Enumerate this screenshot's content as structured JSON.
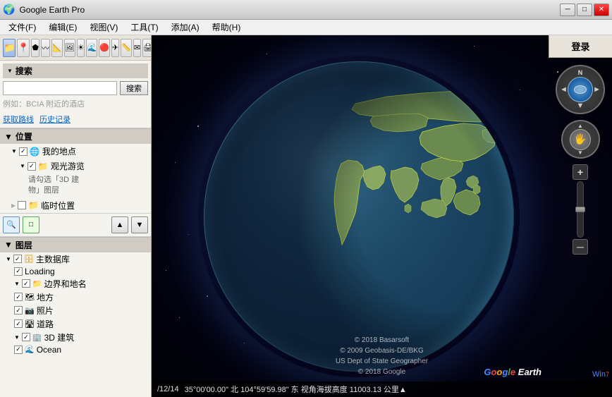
{
  "window": {
    "title": "Google Earth Pro",
    "icon": "🌍"
  },
  "titlebar": {
    "title": "Google Earth Pro",
    "minimize_label": "─",
    "maximize_label": "□",
    "close_label": "✕"
  },
  "menubar": {
    "items": [
      {
        "id": "file",
        "label": "文件(F)"
      },
      {
        "id": "edit",
        "label": "编辑(E)"
      },
      {
        "id": "view",
        "label": "视图(V)"
      },
      {
        "id": "tools",
        "label": "工具(T)"
      },
      {
        "id": "add",
        "label": "添加(A)"
      },
      {
        "id": "help",
        "label": "帮助(H)"
      }
    ]
  },
  "toolbar": {
    "buttons": [
      {
        "id": "folder",
        "icon": "📁",
        "active": true
      },
      {
        "id": "placemark",
        "icon": "📍"
      },
      {
        "id": "polygon",
        "icon": "⬟"
      },
      {
        "id": "path",
        "icon": "〰"
      },
      {
        "id": "measure",
        "icon": "📐"
      },
      {
        "id": "image",
        "icon": "🖼"
      },
      {
        "id": "sun",
        "icon": "☀"
      },
      {
        "id": "ocean",
        "icon": "🌊"
      },
      {
        "id": "mars",
        "icon": "🔴"
      },
      {
        "id": "flight",
        "icon": "✈"
      },
      {
        "id": "ruler",
        "icon": "📏"
      },
      {
        "id": "email",
        "icon": "✉"
      },
      {
        "id": "print",
        "icon": "🖨"
      },
      {
        "id": "movie",
        "icon": "🎬"
      },
      {
        "id": "map2",
        "icon": "🗺"
      }
    ]
  },
  "search": {
    "section_label": "搜索",
    "input_placeholder": "",
    "button_label": "搜索",
    "hint": "例如：BCIA 附近的酒店",
    "links": [
      {
        "id": "route",
        "label": "获取路线"
      },
      {
        "id": "history",
        "label": "历史记录"
      }
    ]
  },
  "position": {
    "section_label": "位置",
    "items": [
      {
        "id": "my-places",
        "label": "我的地点",
        "level": 0,
        "checked": true,
        "icon": "globe"
      },
      {
        "id": "sightseeing",
        "label": "观光游览",
        "level": 1,
        "checked": true,
        "icon": "folder"
      },
      {
        "id": "3d-buildings",
        "label": "请勾选「3D 建\n物」图层",
        "level": 2,
        "checked": false,
        "icon": "text"
      },
      {
        "id": "temp-places",
        "label": "临时位置",
        "level": 0,
        "checked": false,
        "icon": "folder"
      }
    ]
  },
  "nav_buttons": [
    {
      "id": "zoom-in-nav",
      "icon": "🔍",
      "type": "zoom"
    },
    {
      "id": "map-nav",
      "icon": "🗺",
      "type": "map"
    },
    {
      "id": "blank1",
      "icon": ""
    },
    {
      "id": "up-arrow",
      "icon": "▲"
    },
    {
      "id": "down-arrow",
      "icon": "▼"
    }
  ],
  "layers": {
    "section_label": "图层",
    "items": [
      {
        "id": "main-db",
        "label": "主数据库",
        "level": 0,
        "checked": true,
        "icon": "db"
      },
      {
        "id": "loading",
        "label": "Loading",
        "level": 1,
        "checked": true,
        "icon": "check"
      },
      {
        "id": "borders",
        "label": "边界和地名",
        "level": 1,
        "checked": true,
        "icon": "folder"
      },
      {
        "id": "local",
        "label": "地方",
        "level": 1,
        "checked": true,
        "icon": "map"
      },
      {
        "id": "photos",
        "label": "照片",
        "level": 1,
        "checked": true,
        "icon": "photo"
      },
      {
        "id": "roads",
        "label": "道路",
        "level": 1,
        "checked": true,
        "icon": "road"
      },
      {
        "id": "3d-build",
        "label": "3D 建筑",
        "level": 1,
        "checked": true,
        "icon": "building"
      },
      {
        "id": "ocean",
        "label": "Ocean",
        "level": 1,
        "checked": true,
        "icon": "ocean"
      }
    ]
  },
  "login": {
    "button_label": "登录"
  },
  "compass": {
    "n_label": "N",
    "left_arrow": "◄",
    "right_arrow": "►",
    "bottom_arrow": "▼"
  },
  "zoom_control": {
    "plus_label": "+",
    "minus_label": "─"
  },
  "status_bar": {
    "date": "/12/14",
    "coordinates": "35°00'00.00\" 北  104°59'59.98\" 东  视角海拔高度  11003.13 公里▲"
  },
  "copyright": {
    "line1": "© 2018 Basarsoft",
    "line2": "© 2009 Geobasis-DE/BKG",
    "line3": "US Dept of State Geographer",
    "line4": "© 2018 Google"
  },
  "google_earth_brand": "Google Earth",
  "win7_label": "Win7"
}
